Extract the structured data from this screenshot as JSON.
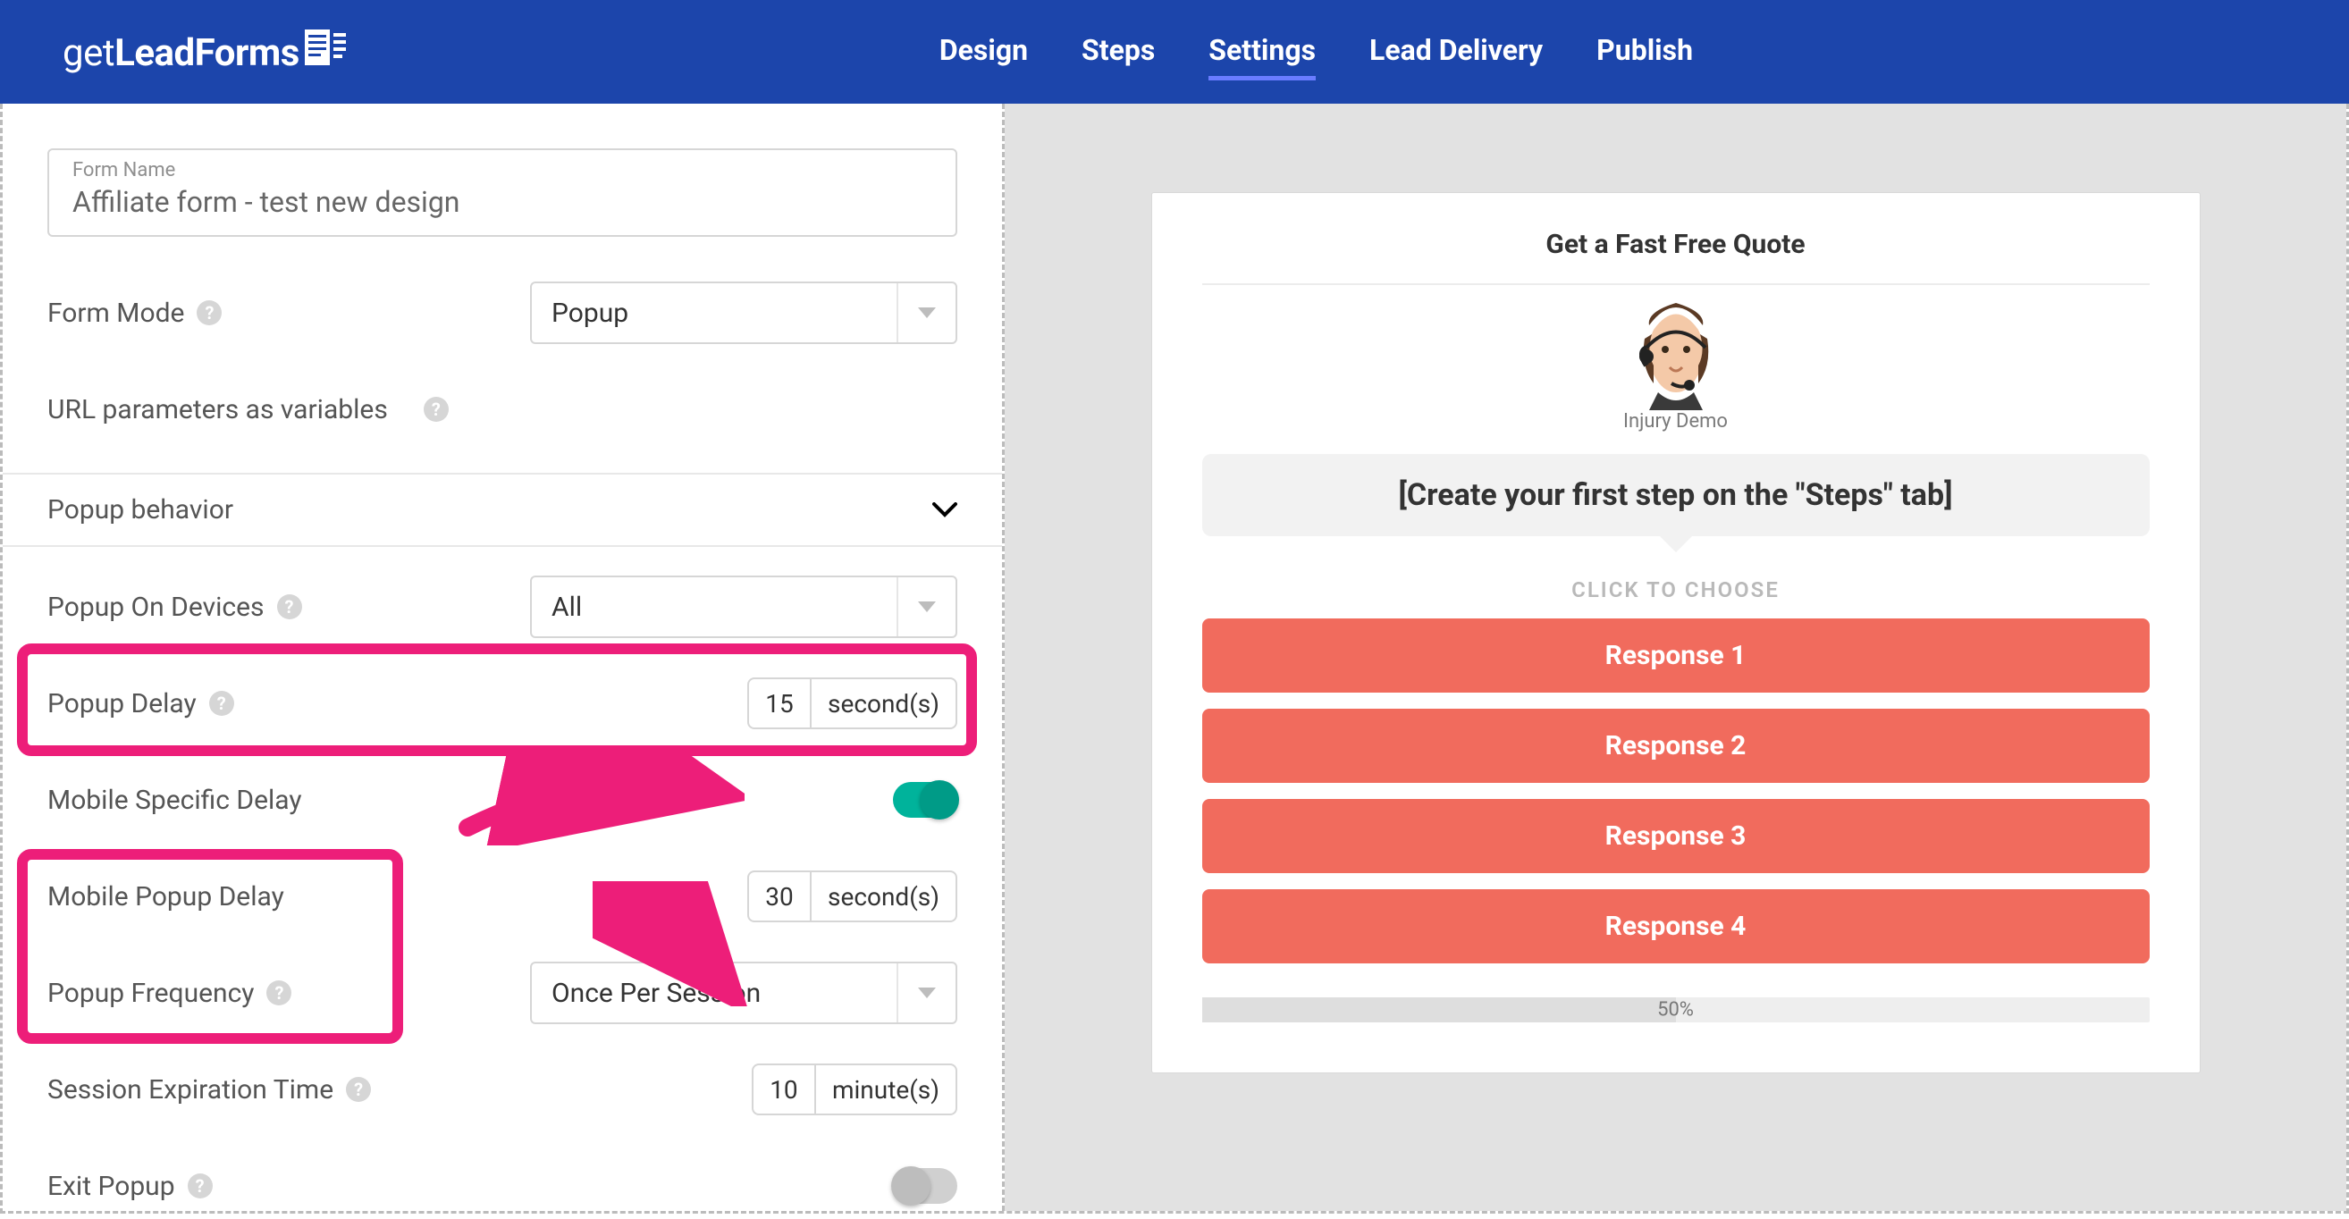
{
  "brand": {
    "prefix": "get",
    "mid": "Lead",
    "suffix": "Forms"
  },
  "nav": {
    "design": "Design",
    "steps": "Steps",
    "settings": "Settings",
    "delivery": "Lead Delivery",
    "publish": "Publish"
  },
  "formName": {
    "label": "Form Name",
    "value": "Affiliate form - test new design"
  },
  "labels": {
    "formMode": "Form Mode",
    "urlParams": "URL parameters as variables",
    "popupBehavior": "Popup behavior",
    "popupOnDevices": "Popup On Devices",
    "popupDelay": "Popup Delay",
    "mobileSpecific": "Mobile Specific Delay",
    "mobilePopupDelay": "Mobile Popup Delay",
    "popupFrequency": "Popup Frequency",
    "sessionExpiration": "Session Expiration Time",
    "exitPopup": "Exit Popup"
  },
  "values": {
    "formMode": "Popup",
    "popupOnDevices": "All",
    "popupDelayNum": "15",
    "popupDelayUnit": "second(s)",
    "mobilePopupDelayNum": "30",
    "mobilePopupDelayUnit": "second(s)",
    "popupFrequency": "Once Per Session",
    "sessionExpNum": "10",
    "sessionExpUnit": "minute(s)"
  },
  "toggles": {
    "mobileSpecific": true,
    "exitPopup": false
  },
  "preview": {
    "title": "Get a Fast Free Quote",
    "agentName": "Injury Demo",
    "stepBanner": "[Create your first step on the \"Steps\" tab]",
    "clickToChoose": "CLICK TO CHOOSE",
    "responses": [
      "Response 1",
      "Response 2",
      "Response 3",
      "Response 4"
    ],
    "progressLabel": "50%",
    "progressPercent": 50
  },
  "colors": {
    "brandBlue": "#1c45ab",
    "accentPink": "#ed1e79",
    "toggleOn": "#00b39b",
    "responseRed": "#f16b5d"
  }
}
